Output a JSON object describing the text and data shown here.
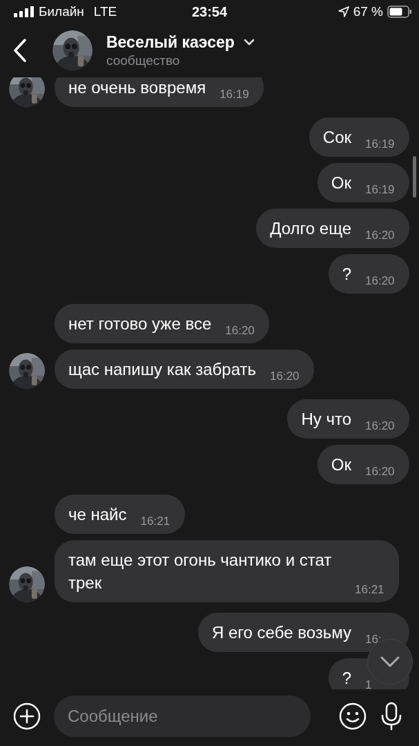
{
  "status_bar": {
    "carrier": "Билайн",
    "network": "LTE",
    "time": "23:54",
    "battery": "67 %"
  },
  "header": {
    "title": "Веселый каэсер",
    "subtitle": "сообщество"
  },
  "messages": [
    {
      "kind": "in",
      "text": "не очень вовремя",
      "time": "16:19",
      "avatar": true
    },
    {
      "kind": "out",
      "text": "Сок",
      "time": "16:19"
    },
    {
      "kind": "out",
      "text": "Ок",
      "time": "16:19"
    },
    {
      "kind": "out",
      "text": "Долго еще",
      "time": "16:20"
    },
    {
      "kind": "out",
      "text": "?",
      "time": "16:20"
    },
    {
      "kind": "in",
      "text": "нет готово уже все",
      "time": "16:20",
      "avatar": false
    },
    {
      "kind": "in",
      "text": "щас напишу как забрать",
      "time": "16:20",
      "avatar": true
    },
    {
      "kind": "out",
      "text": "Ну что",
      "time": "16:20"
    },
    {
      "kind": "out",
      "text": "Ок",
      "time": "16:20"
    },
    {
      "kind": "in",
      "text": "че найс",
      "time": "16:21",
      "avatar": false
    },
    {
      "kind": "in",
      "text": "там еще этот огонь чантико и стат трек",
      "time": "16:21",
      "avatar": true
    },
    {
      "kind": "out",
      "text": "Я его себе возьму",
      "time": "16:"
    },
    {
      "kind": "out",
      "text": "?",
      "time": "1"
    }
  ],
  "composer": {
    "placeholder": "Сообщение"
  }
}
